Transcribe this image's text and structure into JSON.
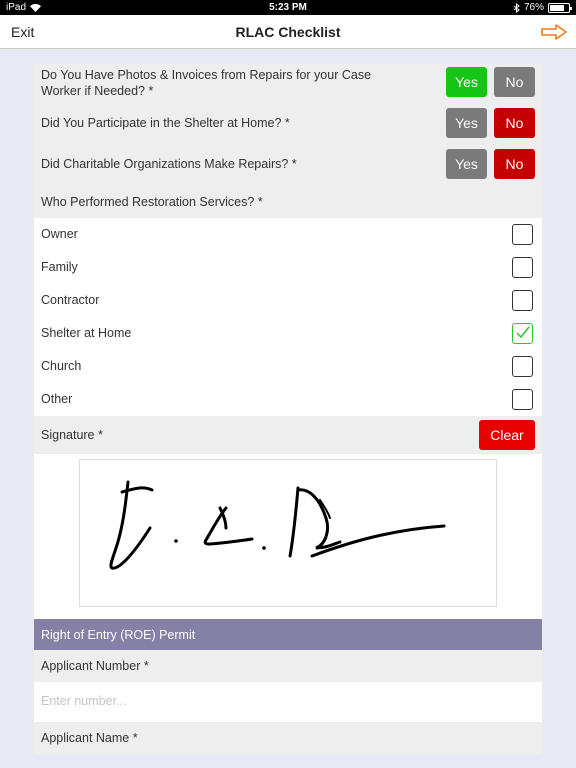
{
  "status_bar": {
    "device": "iPad",
    "time": "5:23 PM",
    "battery": "76%",
    "battery_level": 0.76
  },
  "nav": {
    "exit_label": "Exit",
    "title": "RLAC Checklist",
    "forward_icon": "arrow-right-icon"
  },
  "questions": [
    {
      "text": "Do You Have Photos & Invoices from Repairs for your Case Worker if Needed? *",
      "yes_label": "Yes",
      "no_label": "No",
      "selected": "Yes"
    },
    {
      "text": "Did You Participate in the Shelter at Home? *",
      "yes_label": "Yes",
      "no_label": "No",
      "selected": "No"
    },
    {
      "text": "Did Charitable Organizations Make Repairs? *",
      "yes_label": "Yes",
      "no_label": "No",
      "selected": "No"
    }
  ],
  "restoration": {
    "question": "Who Performed Restoration Services? *",
    "options": [
      {
        "label": "Owner",
        "checked": false
      },
      {
        "label": "Family",
        "checked": false
      },
      {
        "label": "Contractor",
        "checked": false
      },
      {
        "label": "Shelter at Home",
        "checked": true
      },
      {
        "label": "Church",
        "checked": false
      },
      {
        "label": "Other",
        "checked": false
      }
    ]
  },
  "signature": {
    "label": "Signature *",
    "clear_label": "Clear"
  },
  "roe": {
    "title": "Right of Entry (ROE) Permit",
    "applicant_number_label": "Applicant Number *",
    "applicant_number_placeholder": "Enter number...",
    "applicant_number_value": "",
    "applicant_name_label": "Applicant Name *"
  },
  "colors": {
    "yes_selected": "#16c516",
    "no_selected": "#c40000",
    "unselected": "#7a7a7a",
    "clear": "#e60000",
    "section_header": "#8580a6",
    "nav_arrow": "#f07a1a",
    "checked": "#2ec52e"
  }
}
